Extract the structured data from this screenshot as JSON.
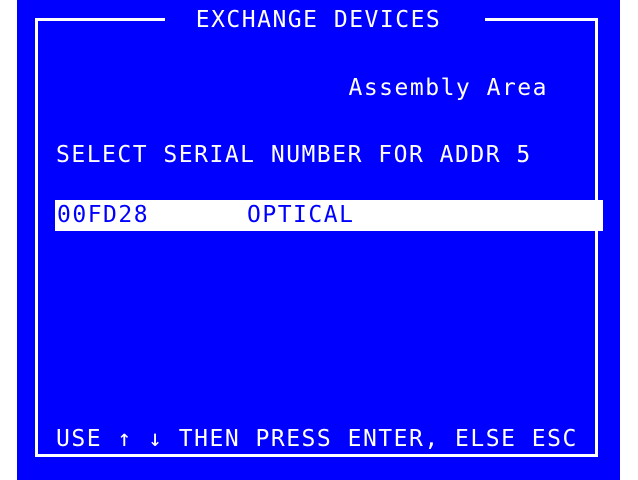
{
  "window": {
    "title": "EXCHANGE DEVICES",
    "area": "Assembly Area"
  },
  "prompt": "SELECT SERIAL NUMBER FOR ADDR 5",
  "devices": [
    {
      "serial": "00FD28",
      "type": "OPTICAL",
      "selected": true
    }
  ],
  "help_text": "USE ↑ ↓ THEN PRESS ENTER, ELSE ESC",
  "colors": {
    "background": "#0000ff",
    "foreground": "#ffffff",
    "selection_bg": "#ffffff",
    "selection_fg": "#0000ff"
  }
}
